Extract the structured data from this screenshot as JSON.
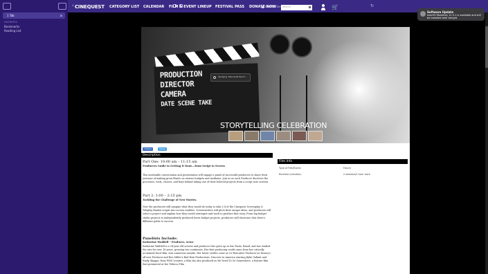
{
  "sidebar": {
    "tab_label": "1 Tab",
    "tab_close": "⊠",
    "section_label": "FAVORITES",
    "links": [
      "Bookmarks",
      "Reading List"
    ]
  },
  "toolbar": {
    "back": "‹",
    "url": "tickets.cinequest.org",
    "reload": "↻"
  },
  "notification": {
    "title": "Software Update",
    "body": "macOS Monterey 12.3.1 is available and will be installed later tonight."
  },
  "nav": {
    "logo": "CINEQUEST",
    "items": [
      "CATEGORY LIST",
      "CALENDAR",
      "FILM & EVENT LINEUP",
      "FESTIVAL PASS",
      "DONATE NOW"
    ],
    "search_placeholder": "Search"
  },
  "hero": {
    "slate_lines": [
      "PRODUCTION",
      "DIRECTOR",
      "CAMERA",
      "DATE   SCENE   TAKE"
    ],
    "title": "STORYTELLING CELEBRATION",
    "toast": "Verifying \"Microsoft Word\"..."
  },
  "social": {
    "share": "f Share",
    "tweet": "Tweet"
  },
  "description": {
    "heading": "Description",
    "part1_title": "Part One: 10:00 am – 11:15 am",
    "part1_subtitle": "Producers Guide to Getting It Done...from Script to Screen",
    "part1_body": "This invaluable conversation and presentation will engage a panel of successful producers to share their journeys of making great film/tv on various budgets and mediums. Join us as each Producer discloses the processes, tools, choices, and keys behind taking one of their beloved projects from a script onto screens.",
    "part2_title": "Part 2: 1:00 – 2:15 pm",
    "part2_subtitle": "Tackling the Challenge of New Stories.",
    "part2_body": "Now the producers will imagine what they would do today to take 2-4 of the Cinequest Screenplay & Teleplay finalist scripts into screen realities. Screenwriters will pitch their unique ideas, and producers will select a project and explain how they would strategize and work to produce that story. From big budget studio projects to independently produced lower budget projects, producers will showcase that there's different paths to success.",
    "panelists_title": "Panelists Include:",
    "panelist_name": "Katherine Waddell – Producer, Actor",
    "panelist_body": "Katherine Waddell is a 24-year-old actress and producer who grew up in São Paulo, Brazil, and has studied the arts for over 18 years, growing two continents. Her first producing credit came from her critically acclaimed short film, won numerous awards. Her latest credits come as Co-Executive Producer on Disney's all-new Producer and Ben Miller's Bad Hair Productions. Discover in America starring Kylie Gallant and Emily Skaggs, from FSH Creative, a film she also produced as We Need To Go Somewhere, a feature film that premiered at the Tribeca Film"
  },
  "film_info": {
    "heading": "Film Info",
    "rows": [
      {
        "label": "Type of Film/Event:",
        "value": "Forum"
      },
      {
        "label": "Runtime (minutes):",
        "value": "2 sessions/1 hour each"
      }
    ]
  }
}
